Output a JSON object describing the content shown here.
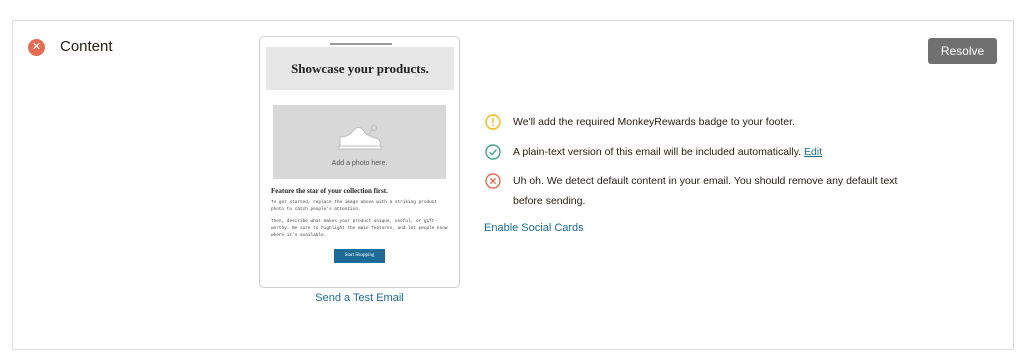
{
  "section": {
    "title": "Content",
    "status": "error",
    "resolve_label": "Resolve"
  },
  "preview": {
    "headline": "Showcase your products.",
    "image_caption": "Add a photo here.",
    "subhead": "Feature the star of your collection first.",
    "body_1": "To get started, replace the image above with a striking product photo to catch people's attention.",
    "body_2": "Then, describe what makes your product unique, useful, or gift-worthy. Be sure to highlight the main features, and let people know where it's available.",
    "cta_label": "Start Shopping",
    "send_test_label": "Send a Test Email"
  },
  "checks": [
    {
      "status": "warning",
      "icon": "warning-circle-icon",
      "text": "We'll add the required MonkeyRewards badge to your footer."
    },
    {
      "status": "success",
      "icon": "check-circle-icon",
      "text": "A plain-text version of this email will be included automatically.",
      "link": "Edit"
    },
    {
      "status": "error",
      "icon": "x-circle-icon",
      "text": "Uh oh. We detect default content in your email. You should remove any default text before sending."
    }
  ],
  "social_cards_label": "Enable Social Cards",
  "colors": {
    "error": "#e36c55",
    "warning": "#f2b90f",
    "success": "#3fa588",
    "link": "#1d6b97",
    "resolve_button": "#707070"
  }
}
